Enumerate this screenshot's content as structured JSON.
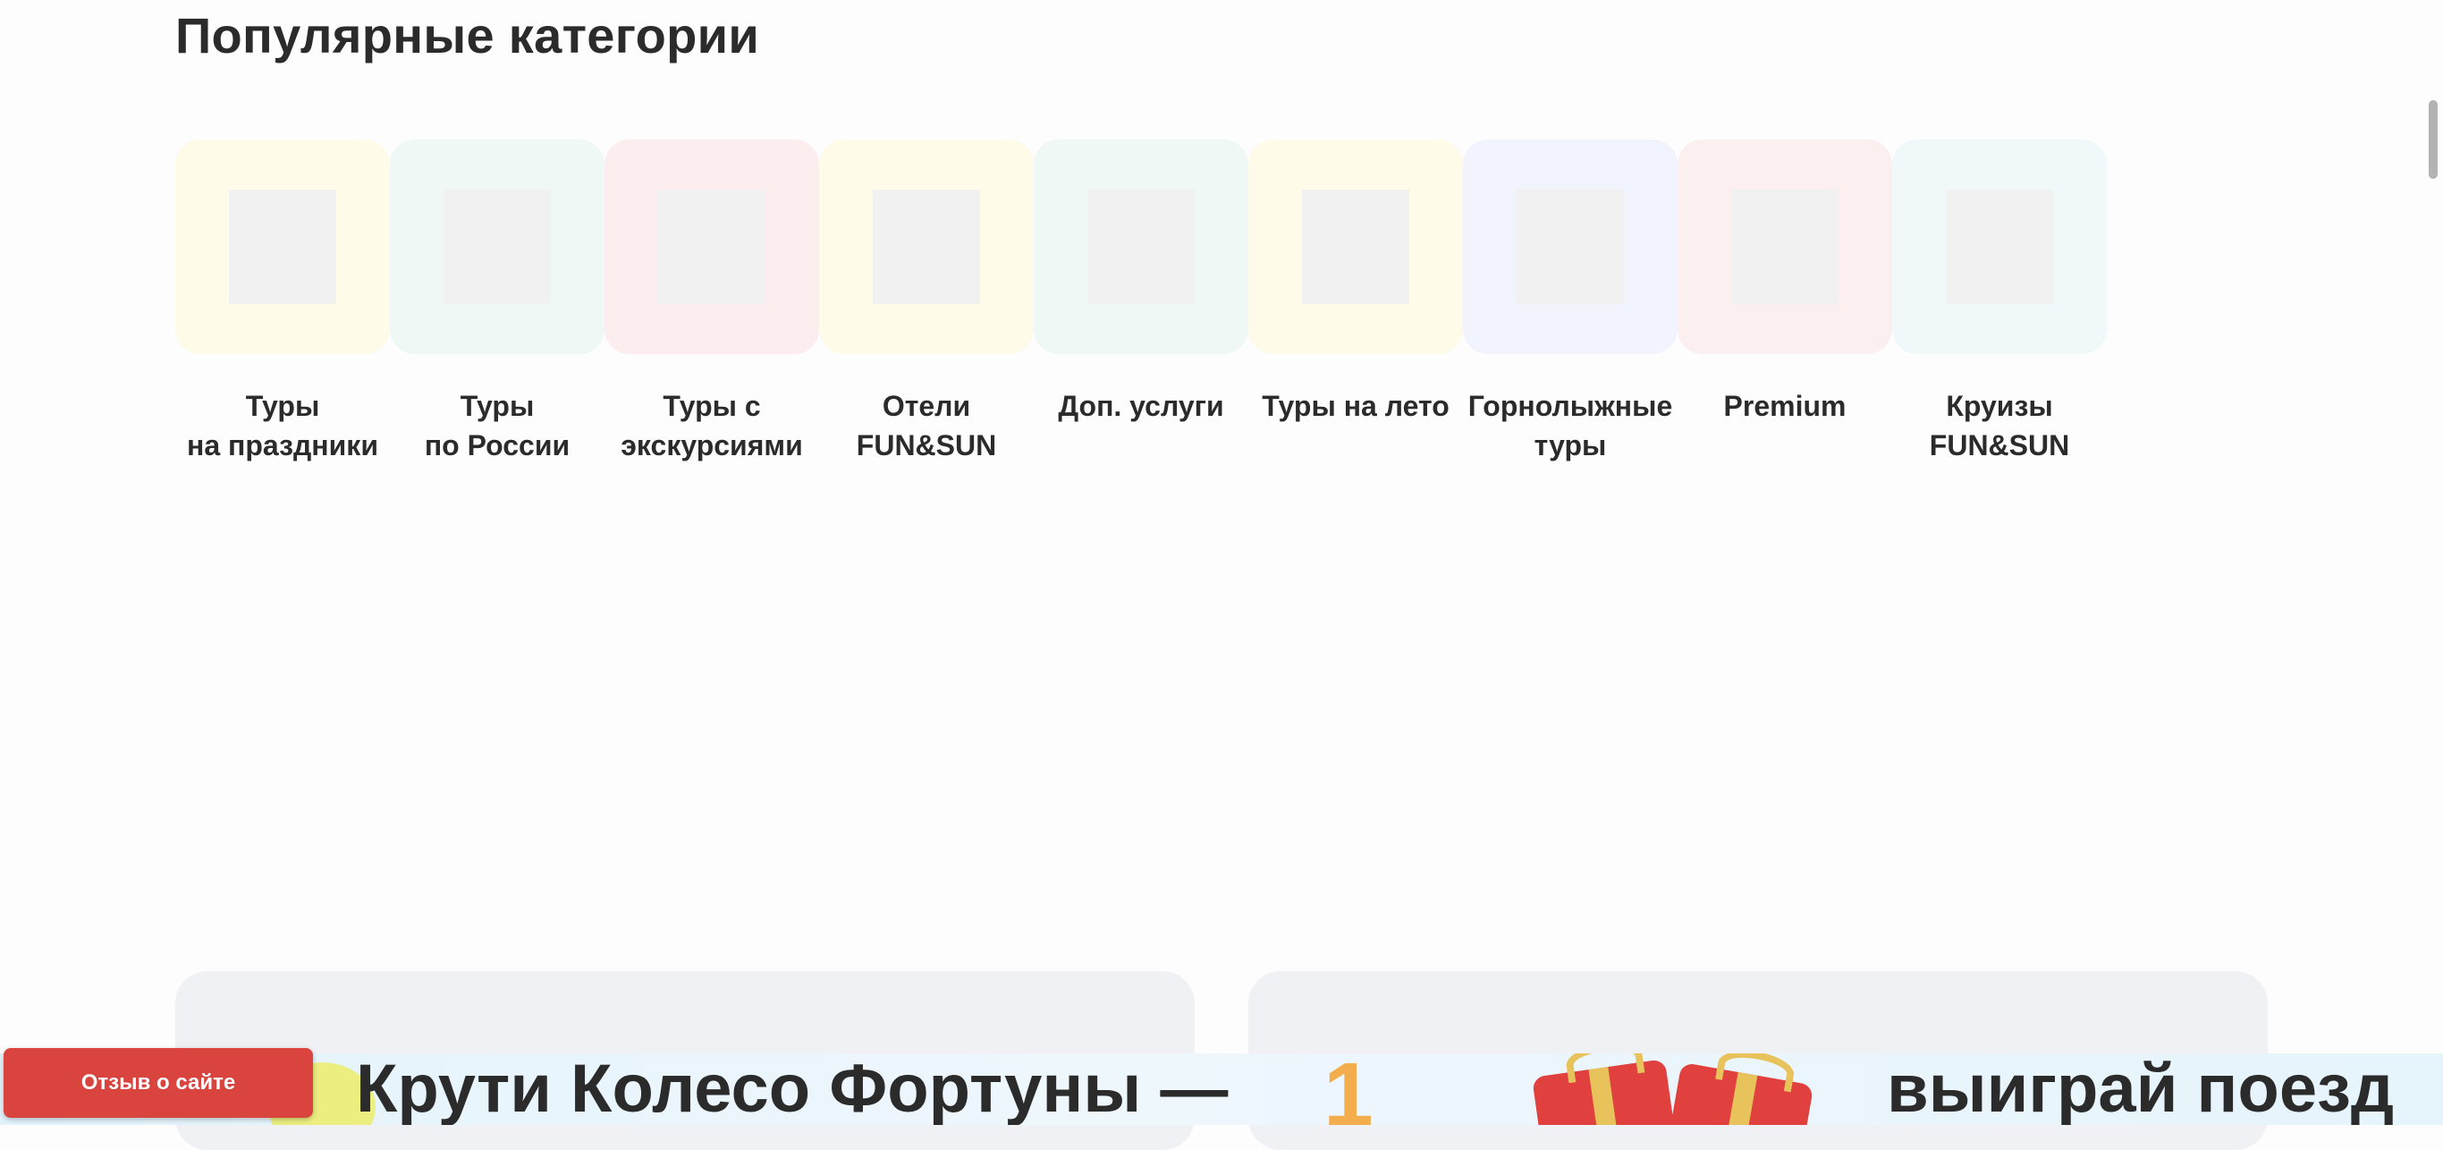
{
  "section": {
    "title": "Популярные категории"
  },
  "categories": [
    {
      "label": "Туры\nна праздники",
      "bg": "#fefbe8"
    },
    {
      "label": "Туры\nпо России",
      "bg": "#eff8f5"
    },
    {
      "label": "Туры с\nэкскурсиями",
      "bg": "#fcedee"
    },
    {
      "label": "Отели\nFUN&SUN",
      "bg": "#fefbe8"
    },
    {
      "label": "Доп. услуги",
      "bg": "#eff8f5"
    },
    {
      "label": "Туры на лето",
      "bg": "#fefbe8"
    },
    {
      "label": "Горнолыжные\nтуры",
      "bg": "#f1f4fc"
    },
    {
      "label": "Premium",
      "bg": "#fcefef"
    },
    {
      "label": "Круизы\nFUN&SUN",
      "bg": "#f0f8fa"
    }
  ],
  "banner": {
    "text_left": "Крути Колесо Фортуны —",
    "text_right": "выиграй поезд",
    "deco_number": "1"
  },
  "feedback": {
    "label": "Отзыв о сайте"
  },
  "colors": {
    "accent": "#d9443f",
    "text": "#2b2b2b",
    "banner_bg": "#e3f3fb"
  }
}
